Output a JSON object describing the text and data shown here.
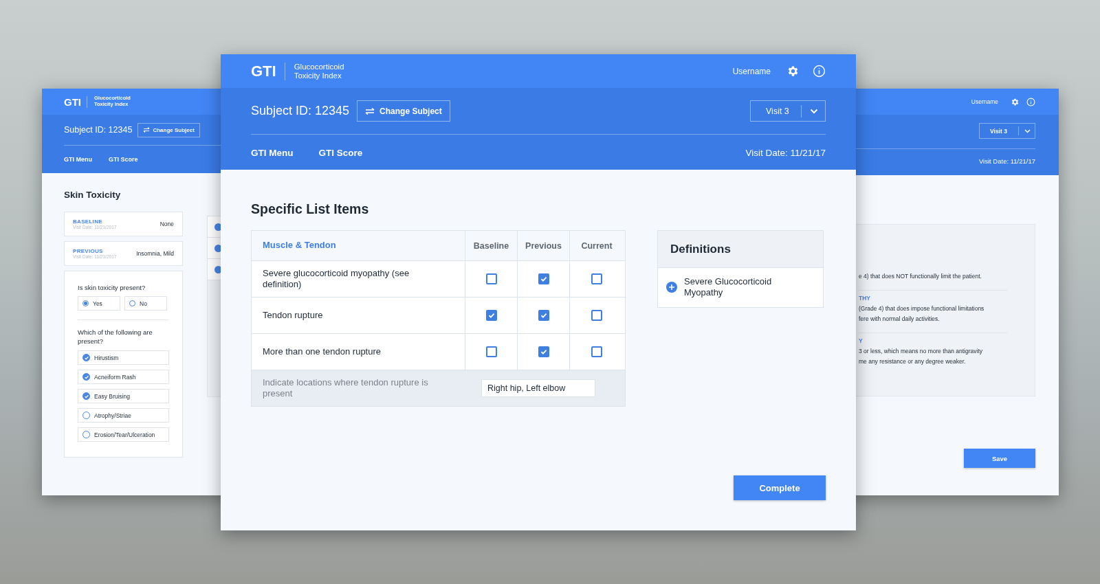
{
  "left_screen": {
    "logo": "GTI",
    "app_name": "Glucocorticoid Toxicity Index",
    "subject_id": "Subject ID: 12345",
    "change_subject": "Change Subject",
    "nav": [
      "GTI Menu",
      "GTI Score"
    ],
    "section_title": "Skin Toxicity",
    "history": [
      {
        "label": "BASELINE",
        "date": "Visit Date: 11/21/2017",
        "value": "None"
      },
      {
        "label": "PREVIOUS",
        "date": "Visit Date: 11/21/2017",
        "value": "Insomnia, Mild"
      }
    ],
    "question": "Is skin toxicity present?",
    "options": [
      {
        "label": "Yes",
        "selected": true
      },
      {
        "label": "No",
        "selected": false
      }
    ],
    "question_2": "Which of the following are present?",
    "checklist": [
      {
        "label": "Hirustism",
        "checked": true
      },
      {
        "label": "Acneiform Rash",
        "checked": true
      },
      {
        "label": "Easy Bruising",
        "checked": true
      },
      {
        "label": "Atrophy/Striae",
        "checked": false
      },
      {
        "label": "Erosion/Tear/Ulceration",
        "checked": false
      }
    ]
  },
  "main_screen": {
    "logo": "GTI",
    "app_name": "Glucocorticoid Toxicity Index",
    "username": "Username",
    "subject_id": "Subject ID: 12345",
    "change_subject": "Change Subject",
    "visit": "Visit 3",
    "nav": [
      "GTI Menu",
      "GTI Score"
    ],
    "visit_date": "Visit Date: 11/21/17",
    "title": "Specific List Items",
    "table": {
      "columns": [
        "Muscle & Tendon",
        "Baseline",
        "Previous",
        "Current"
      ],
      "rows": [
        {
          "label": "Severe glucocorticoid myopathy (see definition)",
          "checks": [
            false,
            true,
            false
          ]
        },
        {
          "label": "Tendon rupture",
          "checks": [
            true,
            true,
            false
          ]
        },
        {
          "label": "More than one tendon rupture",
          "checks": [
            false,
            true,
            false
          ]
        }
      ],
      "footer": {
        "prompt": "Indicate locations where tendon rupture is present",
        "value": "Right hip, Left elbow"
      }
    },
    "definitions": {
      "title": "Definitions",
      "items": [
        "Severe Glucocorticoid Myopathy"
      ]
    },
    "complete": "Complete"
  },
  "right_screen": {
    "username": "Username",
    "visit": "Visit 3",
    "visit_date": "Visit Date: 11/21/17",
    "definitions": [
      {
        "lines": [
          "e 4) that does NOT functionally limit the patient."
        ]
      },
      {
        "heading": "THY",
        "lines": [
          "(Grade 4) that does impose functional limitations",
          "fere with normal daily activities."
        ]
      },
      {
        "heading": "Y",
        "lines": [
          "3 or less, which means no more than antigravity",
          "me any resistance or any degree weaker."
        ]
      }
    ],
    "save": "Save"
  }
}
